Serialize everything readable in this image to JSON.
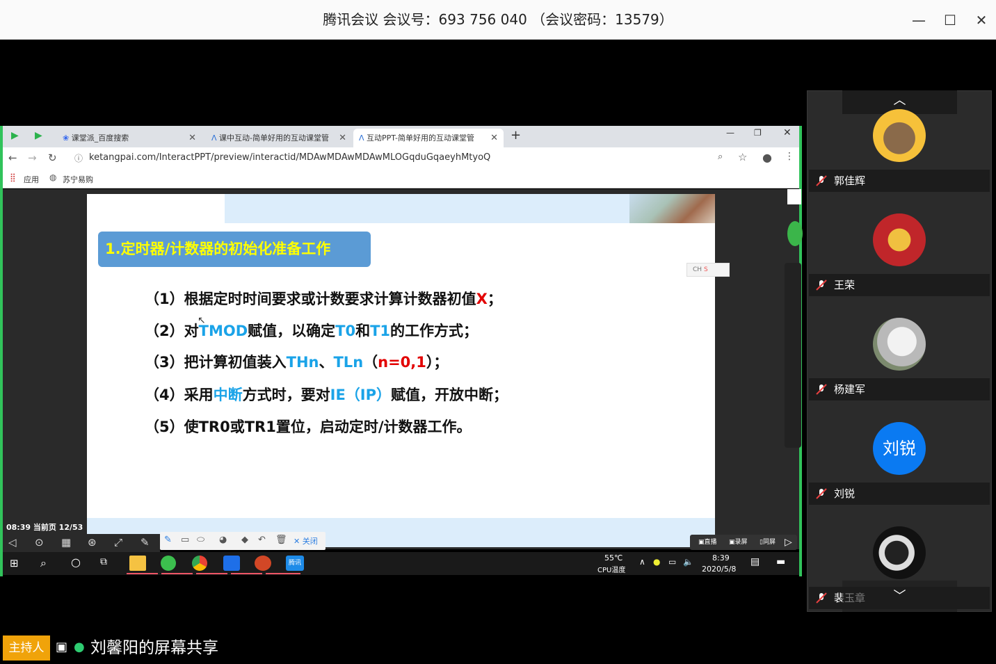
{
  "meeting": {
    "title": "腾讯会议 会议号：693 756 040 （会议密码：13579）"
  },
  "browser": {
    "tabs": [
      {
        "label": "课堂派_百度搜索"
      },
      {
        "label": "课中互动-简单好用的互动课堂管"
      },
      {
        "label": "互动PPT-简单好用的互动课堂管"
      }
    ],
    "url": "ketangpai.com/InteractPPT/preview/interactid/MDAwMDAwMDAwMLOGqduGqaeyhMtyoQ",
    "bookmarks": [
      "应用",
      "苏宁易购"
    ]
  },
  "slide": {
    "heading": "1.定时器/计数器的初始化准备工作",
    "lines": [
      [
        {
          "t": "（1）根据定时时间要求或计数要求计算计数器初值",
          "c": "black"
        },
        {
          "t": "X",
          "c": "red"
        },
        {
          "t": "；",
          "c": "black"
        }
      ],
      [
        {
          "t": "（2）对",
          "c": "black"
        },
        {
          "t": "TMOD",
          "c": "blue"
        },
        {
          "t": "赋值，以确定",
          "c": "black"
        },
        {
          "t": "T0",
          "c": "blue"
        },
        {
          "t": "和",
          "c": "black"
        },
        {
          "t": "T1",
          "c": "blue"
        },
        {
          "t": "的工作方式；",
          "c": "black"
        }
      ],
      [
        {
          "t": "（3）把计算初值装入",
          "c": "black"
        },
        {
          "t": "THn",
          "c": "blue"
        },
        {
          "t": "、",
          "c": "black"
        },
        {
          "t": "TLn",
          "c": "blue"
        },
        {
          "t": "（",
          "c": "black"
        },
        {
          "t": "n=0,1",
          "c": "red"
        },
        {
          "t": "）；",
          "c": "black"
        }
      ],
      [
        {
          "t": "（4）采用",
          "c": "black"
        },
        {
          "t": "中断",
          "c": "blue"
        },
        {
          "t": "方式时，要对",
          "c": "black"
        },
        {
          "t": "IE（IP）",
          "c": "blue"
        },
        {
          "t": "赋值，开放中断；",
          "c": "black"
        }
      ],
      [
        {
          "t": "（5）使TR0或TR1置位，启动定时/计数器工作。",
          "c": "black"
        }
      ]
    ]
  },
  "presenter": {
    "page_info": "08:39 当前页 12/53",
    "right_tools": [
      "直播",
      "录屏",
      "同屏"
    ],
    "close": "关闭",
    "ime": "CH"
  },
  "taskbar": {
    "temp": "55℃",
    "temp_label": "CPU温度",
    "time": "8:39",
    "date": "2020/5/8",
    "app_label": "腾讯"
  },
  "participants": [
    {
      "name": "郭佳辉"
    },
    {
      "name": "王荣"
    },
    {
      "name": "杨建军"
    },
    {
      "name": "刘锐",
      "initials": "刘锐"
    },
    {
      "name": "裴玉章"
    }
  ],
  "footer": {
    "host_tag": "主持人",
    "sharer": "刘馨阳的屏幕共享"
  }
}
